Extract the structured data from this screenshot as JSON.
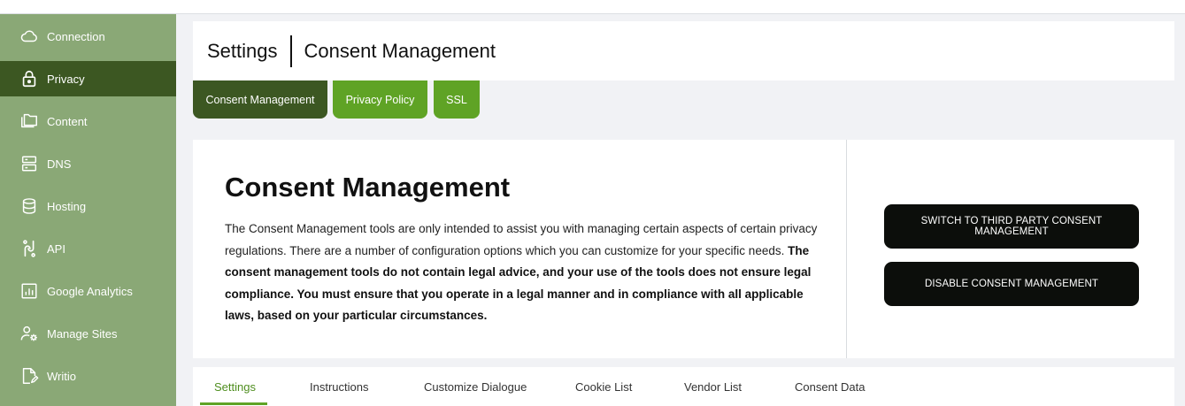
{
  "sidebar": {
    "items": [
      {
        "label": "Connection",
        "icon": "cloud-icon"
      },
      {
        "label": "Privacy",
        "icon": "lock-icon",
        "active": true
      },
      {
        "label": "Content",
        "icon": "folders-icon"
      },
      {
        "label": "DNS",
        "icon": "server-icon"
      },
      {
        "label": "Hosting",
        "icon": "database-icon"
      },
      {
        "label": "API",
        "icon": "api-icon"
      },
      {
        "label": "Google Analytics",
        "icon": "analytics-chart-icon"
      },
      {
        "label": "Manage Sites",
        "icon": "user-gear-icon"
      },
      {
        "label": "Writio",
        "icon": "document-edit-icon"
      }
    ]
  },
  "header": {
    "title": "Settings",
    "subtitle": "Consent Management"
  },
  "tabs": [
    {
      "label": "Consent Management",
      "active": true
    },
    {
      "label": "Privacy Policy"
    },
    {
      "label": "SSL"
    }
  ],
  "main": {
    "title": "Consent Management",
    "desc_normal": "The Consent Management tools are only intended to assist you with managing certain aspects of certain privacy regulations. There are a number of configuration options which you can customize for your specific needs. ",
    "desc_bold": "The consent management tools do not contain legal advice, and your use of the tools does not ensure legal compliance. You must ensure that you operate in a legal manner and in compliance with all applicable laws, based on your particular circumstances.",
    "buttons": {
      "switch_label": "SWITCH TO THIRD PARTY CONSENT MANAGEMENT",
      "disable_label": "DISABLE CONSENT MANAGEMENT"
    }
  },
  "bottom_tabs": [
    {
      "label": "Settings",
      "active": true
    },
    {
      "label": "Instructions"
    },
    {
      "label": "Customize Dialogue"
    },
    {
      "label": "Cookie List"
    },
    {
      "label": "Vendor List"
    },
    {
      "label": "Consent Data"
    }
  ],
  "colors": {
    "sidebar_bg": "#8aa876",
    "sidebar_active": "#3c5722",
    "tab_secondary": "#5fa325",
    "button_bg": "#0c0e0b",
    "accent_green": "#5fa325"
  }
}
